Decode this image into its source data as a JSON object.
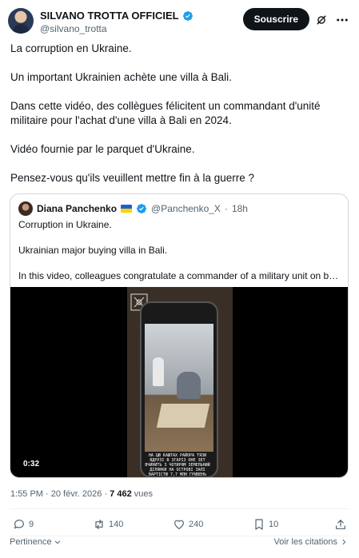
{
  "author": {
    "name": "SILVANO TROTTA OFFICIEL",
    "handle": "@silvano_trotta"
  },
  "header": {
    "follow_label": "Souscrire"
  },
  "tweet": {
    "paragraphs": [
      "La corruption en Ukraine.",
      "Un important Ukrainien achète une villa à Bali.",
      "Dans cette vidéo, des collègues félicitent un commandant d'unité militaire pour l'achat d'une villa à Bali en 2024.",
      "Vidéo fournie par le parquet d'Ukraine.",
      "Pensez-vous qu'ils veuillent mettre fin à la guerre ?"
    ]
  },
  "quote": {
    "name": "Diana Panchenko",
    "handle": "@Panchenko_X",
    "separator": "·",
    "time": "18h",
    "paragraphs": [
      "Corruption in Ukraine.",
      "Ukrainian major buying villa in Bali.",
      "In this video, colleagues congratulate a commander of a military unit on buyi…"
    ],
    "video": {
      "duration": "0:32",
      "overlay_lines": [
        "НА ЦЮ КАШТАХ РАЙОРА ТЯЗИ",
        "ВДРУЗІ В ЗГАРІЗ ОНЕ ЗЕТ",
        "ВЧИНИТЬ З ЧОТИРЯМ ЗЕМЕЛЬНИЙ",
        "ДІЛЯНКИ НА ОСТРОВІ ЗАЛІ",
        "ВАРТІСТЮ 7,7 МЛН ГРИВЕНЬ"
      ]
    }
  },
  "meta": {
    "time": "1:55 PM",
    "dot": "·",
    "date": "20 févr. 2026",
    "views_count": "7 462",
    "views_label": "vues"
  },
  "actions": {
    "replies": "9",
    "reposts": "140",
    "likes": "240",
    "bookmarks": "10"
  },
  "footer": {
    "relevance_label": "Pertinence",
    "quotes_label": "Voir les citations"
  },
  "colors": {
    "verified": "#1d9bf0",
    "text_primary": "#0f1419",
    "text_secondary": "#536471",
    "border": "#cfd9de"
  }
}
